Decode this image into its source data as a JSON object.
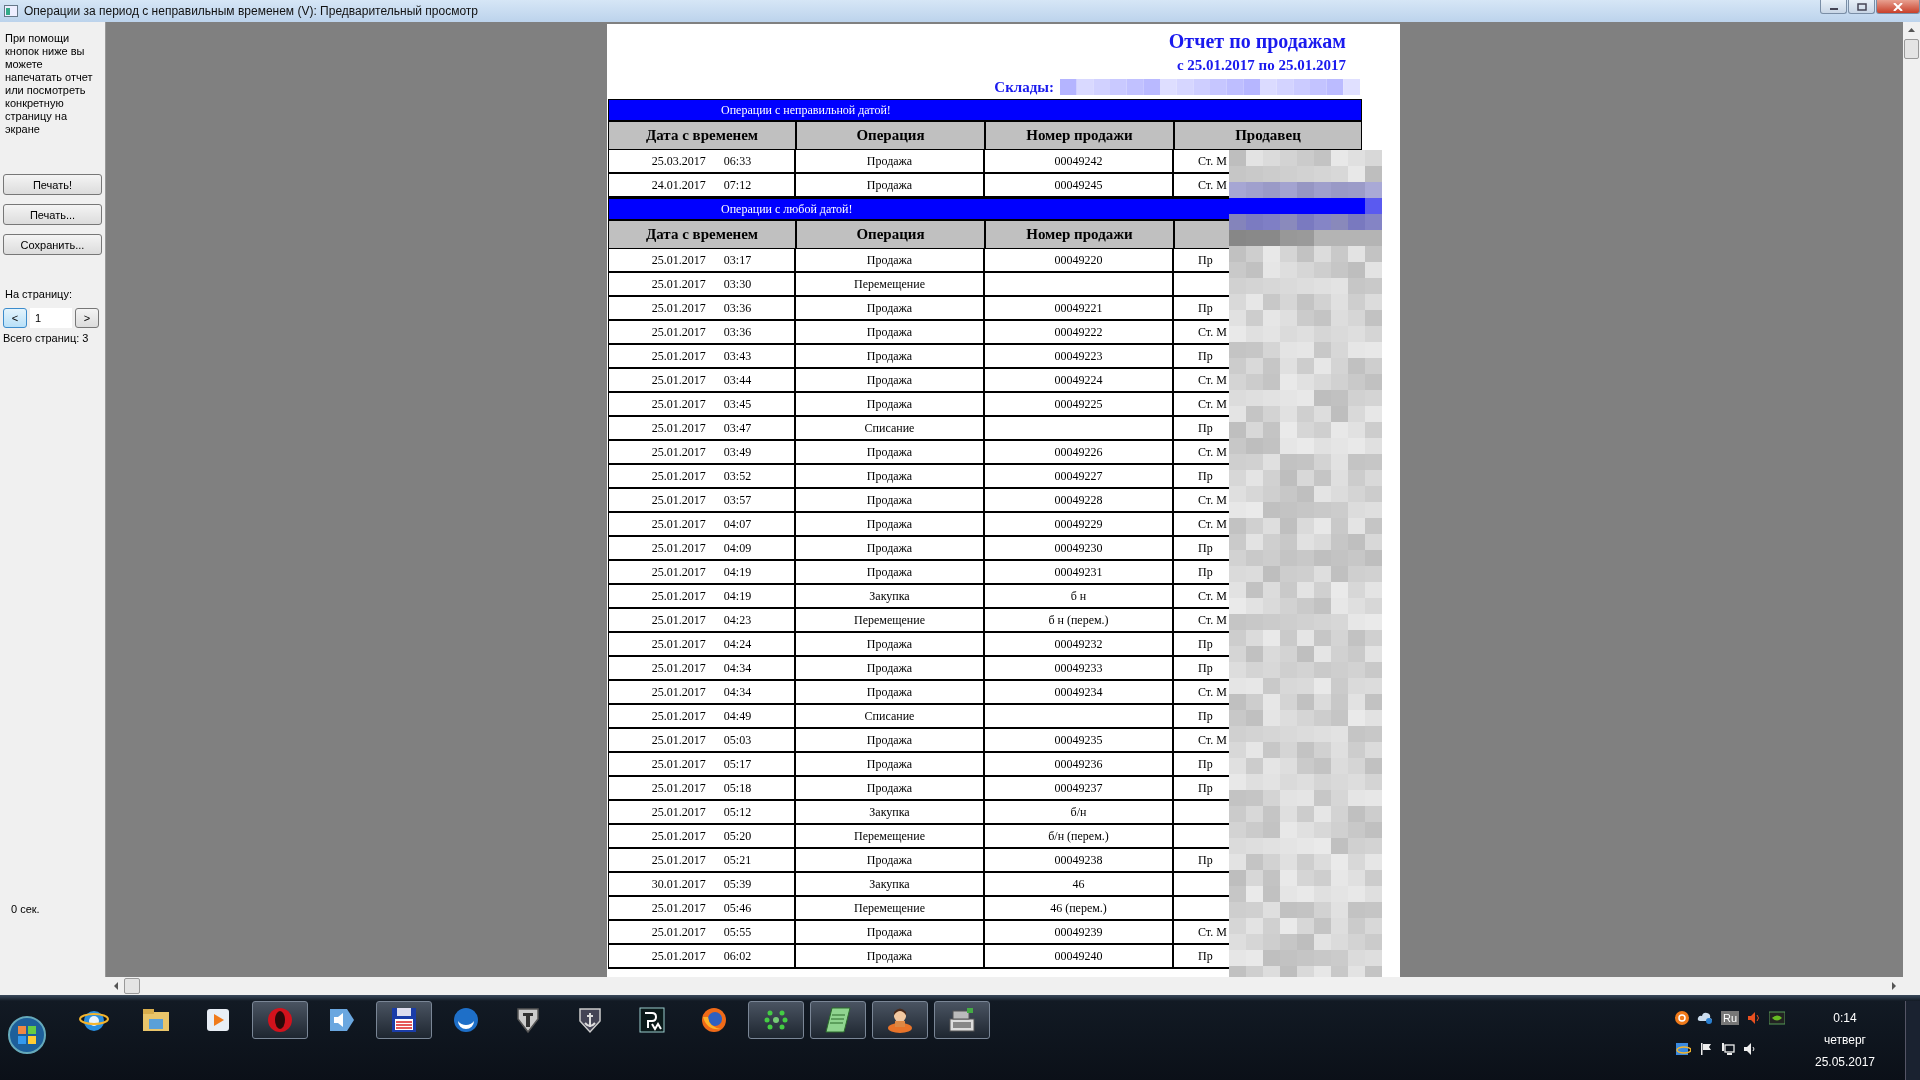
{
  "window": {
    "title": "Операции за период с неправильным временем (V): Предварительный просмотр"
  },
  "sidebar": {
    "hint": "При помощи кнопок ниже вы можете напечатать отчет или посмотреть конкретную страницу на экране",
    "buttons": [
      "Печать!",
      "Печать...",
      "Сохранить..."
    ],
    "page_label": "На страницу:",
    "prev": {
      "label": "<",
      "focused": true
    },
    "page_field": {
      "value": "1"
    },
    "next": {
      "label": ">",
      "focused": false
    },
    "total_pages": "Всего страниц: 3",
    "timer": "0 сек."
  },
  "report": {
    "title": "Отчет по продажам",
    "period": "с 25.01.2017 по 25.01.2017",
    "warehouses_label": "Склады:",
    "sections": [
      {
        "heading": "Операции с неправильной датой!",
        "columns": [
          "Дата с временем",
          "Операция",
          "Номер продажи",
          "Продавец"
        ],
        "rows": [
          {
            "date": "25.03.2017",
            "time": "06:33",
            "operation": "Продажа",
            "number": "00049242",
            "seller": "Ст. М"
          },
          {
            "date": "24.01.2017",
            "time": "07:12",
            "operation": "Продажа",
            "number": "00049245",
            "seller": "Ст. М"
          }
        ]
      },
      {
        "heading": "Операции с любой датой!",
        "columns": [
          "Дата с временем",
          "Операция",
          "Номер продажи"
        ],
        "rows": [
          {
            "date": "25.01.2017",
            "time": "03:17",
            "operation": "Продажа",
            "number": "00049220",
            "seller": "Пр"
          },
          {
            "date": "25.01.2017",
            "time": "03:30",
            "operation": "Перемещение",
            "number": "",
            "seller": ""
          },
          {
            "date": "25.01.2017",
            "time": "03:36",
            "operation": "Продажа",
            "number": "00049221",
            "seller": "Пр"
          },
          {
            "date": "25.01.2017",
            "time": "03:36",
            "operation": "Продажа",
            "number": "00049222",
            "seller": "Ст. М"
          },
          {
            "date": "25.01.2017",
            "time": "03:43",
            "operation": "Продажа",
            "number": "00049223",
            "seller": "Пр"
          },
          {
            "date": "25.01.2017",
            "time": "03:44",
            "operation": "Продажа",
            "number": "00049224",
            "seller": "Ст. М"
          },
          {
            "date": "25.01.2017",
            "time": "03:45",
            "operation": "Продажа",
            "number": "00049225",
            "seller": "Ст. М"
          },
          {
            "date": "25.01.2017",
            "time": "03:47",
            "operation": "Списание",
            "number": "",
            "seller": "Пр"
          },
          {
            "date": "25.01.2017",
            "time": "03:49",
            "operation": "Продажа",
            "number": "00049226",
            "seller": "Ст. М"
          },
          {
            "date": "25.01.2017",
            "time": "03:52",
            "operation": "Продажа",
            "number": "00049227",
            "seller": "Пр"
          },
          {
            "date": "25.01.2017",
            "time": "03:57",
            "operation": "Продажа",
            "number": "00049228",
            "seller": "Ст. М"
          },
          {
            "date": "25.01.2017",
            "time": "04:07",
            "operation": "Продажа",
            "number": "00049229",
            "seller": "Ст. М"
          },
          {
            "date": "25.01.2017",
            "time": "04:09",
            "operation": "Продажа",
            "number": "00049230",
            "seller": "Пр"
          },
          {
            "date": "25.01.2017",
            "time": "04:19",
            "operation": "Продажа",
            "number": "00049231",
            "seller": "Пр"
          },
          {
            "date": "25.01.2017",
            "time": "04:19",
            "operation": "Закупка",
            "number": "б н",
            "seller": "Ст. М"
          },
          {
            "date": "25.01.2017",
            "time": "04:23",
            "operation": "Перемещение",
            "number": "б н (перем.)",
            "seller": "Ст. М"
          },
          {
            "date": "25.01.2017",
            "time": "04:24",
            "operation": "Продажа",
            "number": "00049232",
            "seller": "Пр"
          },
          {
            "date": "25.01.2017",
            "time": "04:34",
            "operation": "Продажа",
            "number": "00049233",
            "seller": "Пр"
          },
          {
            "date": "25.01.2017",
            "time": "04:34",
            "operation": "Продажа",
            "number": "00049234",
            "seller": "Ст. М"
          },
          {
            "date": "25.01.2017",
            "time": "04:49",
            "operation": "Списание",
            "number": "",
            "seller": "Пр"
          },
          {
            "date": "25.01.2017",
            "time": "05:03",
            "operation": "Продажа",
            "number": "00049235",
            "seller": "Ст. М"
          },
          {
            "date": "25.01.2017",
            "time": "05:17",
            "operation": "Продажа",
            "number": "00049236",
            "seller": "Пр"
          },
          {
            "date": "25.01.2017",
            "time": "05:18",
            "operation": "Продажа",
            "number": "00049237",
            "seller": "Пр"
          },
          {
            "date": "25.01.2017",
            "time": "05:12",
            "operation": "Закупка",
            "number": "б/н",
            "seller": ""
          },
          {
            "date": "25.01.2017",
            "time": "05:20",
            "operation": "Перемещение",
            "number": "б/н (перем.)",
            "seller": ""
          },
          {
            "date": "25.01.2017",
            "time": "05:21",
            "operation": "Продажа",
            "number": "00049238",
            "seller": "Пр"
          },
          {
            "date": "30.01.2017",
            "time": "05:39",
            "operation": "Закупка",
            "number": "46",
            "seller": ""
          },
          {
            "date": "25.01.2017",
            "time": "05:46",
            "operation": "Перемещение",
            "number": "46 (перем.)",
            "seller": ""
          },
          {
            "date": "25.01.2017",
            "time": "05:55",
            "operation": "Продажа",
            "number": "00049239",
            "seller": "Ст. М"
          },
          {
            "date": "25.01.2017",
            "time": "06:02",
            "operation": "Продажа",
            "number": "00049240",
            "seller": "Пр"
          }
        ]
      }
    ]
  },
  "taskbar": {
    "items": [
      {
        "running": false
      },
      {
        "running": false
      },
      {
        "running": false
      },
      {
        "running": true
      },
      {
        "running": false
      },
      {
        "running": true
      },
      {
        "running": false
      },
      {
        "running": false
      },
      {
        "running": false
      },
      {
        "running": false
      },
      {
        "running": false
      },
      {
        "running": true
      },
      {
        "running": true
      },
      {
        "running": true
      },
      {
        "running": true
      }
    ]
  },
  "tray": {
    "language": "Ru",
    "time": "0:14",
    "day": "четверг",
    "date": "25.05.2017"
  }
}
